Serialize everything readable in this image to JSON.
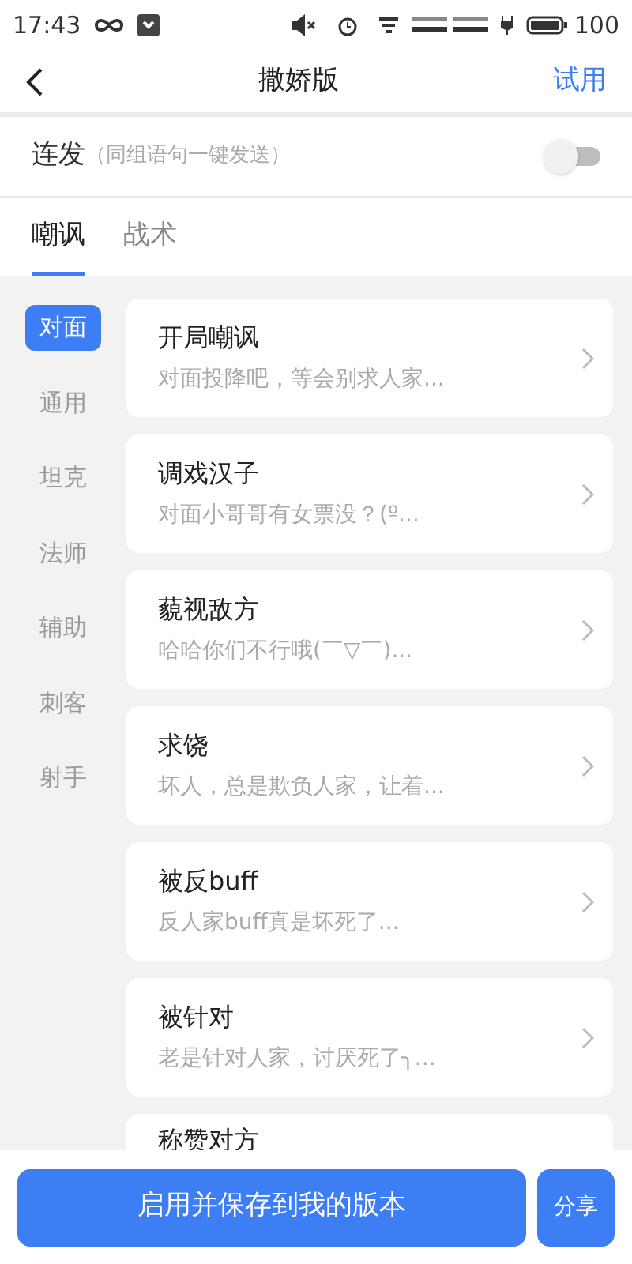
{
  "status_bar": {
    "time": "17:43",
    "battery": "100"
  },
  "header": {
    "title": "撒娇版",
    "action": "试用"
  },
  "burst": {
    "label": "连发",
    "hint": "（同组语句一键发送）",
    "on": false
  },
  "tabs": [
    {
      "label": "嘲讽",
      "selected": true
    },
    {
      "label": "战术",
      "selected": false
    }
  ],
  "categories": [
    {
      "label": "对面",
      "selected": true
    },
    {
      "label": "通用",
      "selected": false
    },
    {
      "label": "坦克",
      "selected": false
    },
    {
      "label": "法师",
      "selected": false
    },
    {
      "label": "辅助",
      "selected": false
    },
    {
      "label": "刺客",
      "selected": false
    },
    {
      "label": "射手",
      "selected": false
    }
  ],
  "phrases": [
    {
      "title": "开局嘲讽",
      "preview": "对面投降吧，等会别求人家..."
    },
    {
      "title": "调戏汉子",
      "preview": "对面小哥哥有女票没？(º..."
    },
    {
      "title": "藐视敌方",
      "preview": "哈哈你们不行哦(￣▽￣)..."
    },
    {
      "title": "求饶",
      "preview": "坏人，总是欺负人家，让着..."
    },
    {
      "title": "被反buff",
      "preview": "反人家buff真是坏死了..."
    },
    {
      "title": "被针对",
      "preview": "老是针对人家，讨厌死了╮..."
    },
    {
      "title": "称赞对方"
    }
  ],
  "buttons": {
    "primary": "启用并保存到我的版本",
    "secondary": "分享"
  }
}
